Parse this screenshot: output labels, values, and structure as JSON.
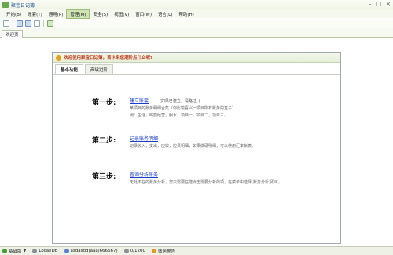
{
  "window": {
    "title": "聚宝日记簿"
  },
  "menu": [
    {
      "label": "开始(B)"
    },
    {
      "label": "账套(T)"
    },
    {
      "label": "通用(P)"
    },
    {
      "label": "管理(M)",
      "active": true
    },
    {
      "label": "安全(S)"
    },
    {
      "label": "视图(V)"
    },
    {
      "label": "窗口(W)"
    },
    {
      "label": "语言(L)"
    },
    {
      "label": "帮助(H)"
    }
  ],
  "doctab": {
    "label": "欢迎页"
  },
  "panel": {
    "welcome": "欢迎使用聚宝日记簿，首卡来您潮阶点什么呢?",
    "tabs": [
      {
        "label": "基本功能",
        "active": true
      },
      {
        "label": "高级进阶",
        "active": false
      }
    ],
    "steps": [
      {
        "num": "第一步:",
        "link": "建立账套",
        "note": "(如果已建立，请略过。)",
        "lines": [
          "某项目的账务明细合集（你比喻喜兴一项目所有账务的盒子）",
          "例：生活，喝旋经营，服水，项目一，项目二，项目三。"
        ]
      },
      {
        "num": "第二步:",
        "link": "记录账务明细",
        "note": "",
        "lines": [
          "记录收入，支出，应收，应员明细，如果做硬明细，可以使用汇率帐表。"
        ]
      },
      {
        "num": "第三步:",
        "link": "查询分析账务",
        "note": "",
        "lines": [
          "无处不在的账务分析，您只需要在建点击需要分析的项，在菜单中选择[账务分析]即可。"
        ]
      }
    ]
  },
  "status": {
    "edition": "基础版",
    "db": "Local/DB",
    "user": "asdasdd(aaa/666667)",
    "count": "0/1200",
    "alert": "账务警告"
  }
}
